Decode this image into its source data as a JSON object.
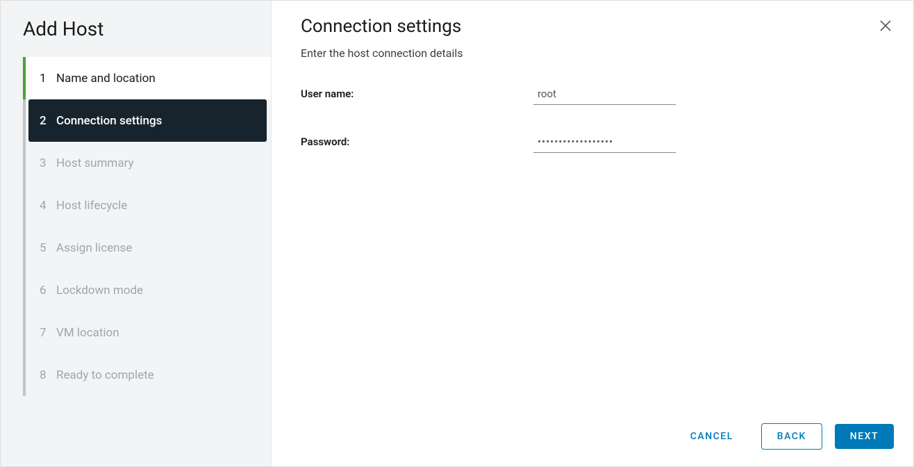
{
  "wizard": {
    "title": "Add Host",
    "steps": [
      {
        "num": "1",
        "label": "Name and location",
        "state": "completed"
      },
      {
        "num": "2",
        "label": "Connection settings",
        "state": "active"
      },
      {
        "num": "3",
        "label": "Host summary",
        "state": "pending"
      },
      {
        "num": "4",
        "label": "Host lifecycle",
        "state": "pending"
      },
      {
        "num": "5",
        "label": "Assign license",
        "state": "pending"
      },
      {
        "num": "6",
        "label": "Lockdown mode",
        "state": "pending"
      },
      {
        "num": "7",
        "label": "VM location",
        "state": "pending"
      },
      {
        "num": "8",
        "label": "Ready to complete",
        "state": "pending"
      }
    ]
  },
  "panel": {
    "title": "Connection settings",
    "subtitle": "Enter the host connection details",
    "username_label": "User name:",
    "username_value": "root",
    "password_label": "Password:",
    "password_value": "••••••••••••••••••"
  },
  "footer": {
    "cancel": "CANCEL",
    "back": "BACK",
    "next": "NEXT"
  }
}
